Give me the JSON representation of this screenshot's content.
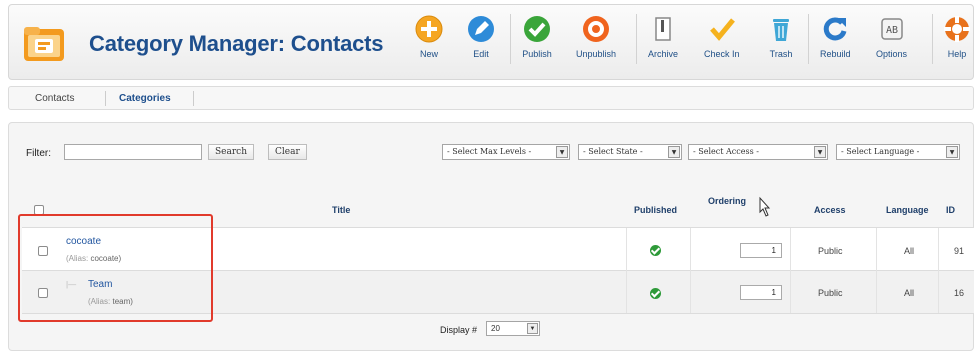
{
  "header": {
    "title": "Category Manager: Contacts",
    "icon": "category-folder-icon"
  },
  "toolbar": {
    "buttons": [
      {
        "label": "New",
        "icon": "new-icon",
        "color": "#f5a623"
      },
      {
        "label": "Edit",
        "icon": "edit-icon",
        "color": "#2e8bd8"
      },
      {
        "label": "Publish",
        "icon": "publish-icon",
        "color": "#3aa53a"
      },
      {
        "label": "Unpublish",
        "icon": "unpublish-icon",
        "color": "#f0641e"
      },
      {
        "label": "Archive",
        "icon": "archive-icon",
        "color": "#888888"
      },
      {
        "label": "Check In",
        "icon": "check-in-icon",
        "color": "#f5b21e"
      },
      {
        "label": "Trash",
        "icon": "trash-icon",
        "color": "#3fa7d6"
      },
      {
        "label": "Rebuild",
        "icon": "rebuild-icon",
        "color": "#2b7ac9"
      },
      {
        "label": "Options",
        "icon": "options-icon",
        "color": "#777777"
      },
      {
        "label": "Help",
        "icon": "help-icon",
        "color": "#e8721c"
      }
    ]
  },
  "submenu": {
    "items": [
      {
        "label": "Contacts",
        "active": false
      },
      {
        "label": "Categories",
        "active": true
      }
    ]
  },
  "filter": {
    "label": "Filter:",
    "search_value": "",
    "search_button": "Search",
    "clear_button": "Clear",
    "selects": [
      "- Select Max Levels -",
      "- Select State -",
      "- Select Access -",
      "- Select Language -"
    ]
  },
  "table": {
    "headers": {
      "title": "Title",
      "published": "Published",
      "ordering": "Ordering",
      "access": "Access",
      "language": "Language",
      "id": "ID"
    },
    "rows": [
      {
        "title": "cocoate",
        "alias_label": "(Alias:",
        "alias_value": "cocoate)",
        "published": true,
        "ordering": "1",
        "access": "Public",
        "language": "All",
        "id": "91",
        "level_prefix": ""
      },
      {
        "title": "Team",
        "alias_label": "(Alias:",
        "alias_value": "team)",
        "published": true,
        "ordering": "1",
        "access": "Public",
        "language": "All",
        "id": "16",
        "level_prefix": "|—"
      }
    ]
  },
  "pagination": {
    "display_label": "Display #",
    "display_value": "20"
  },
  "colors": {
    "title_blue": "#1e4f8d",
    "link_blue": "#2256a0",
    "highlight_red": "#e13a2c",
    "published_green": "#2e9a39"
  }
}
